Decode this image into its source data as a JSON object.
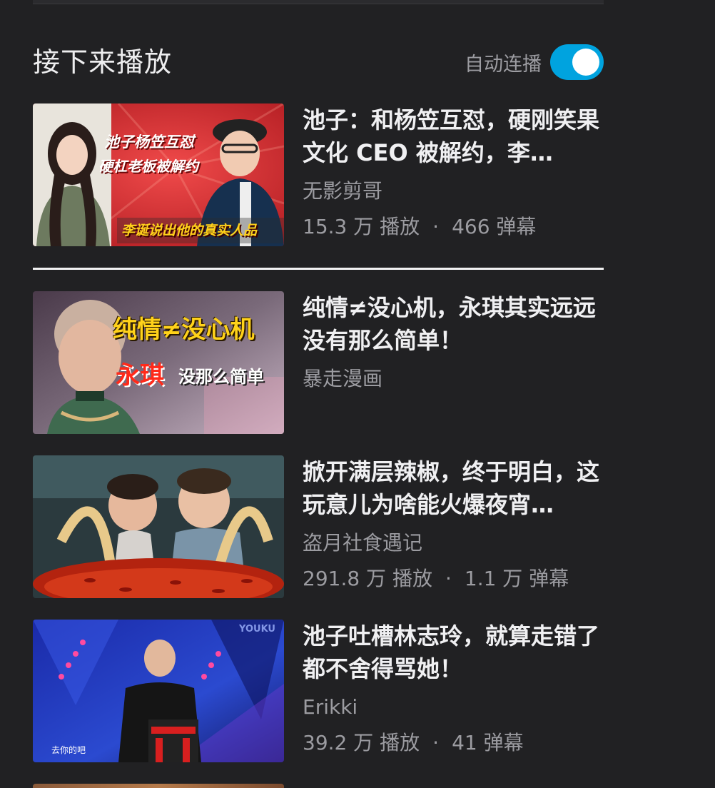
{
  "header": {
    "title": "接下来播放",
    "autoplay_label": "自动连播",
    "autoplay_on": true
  },
  "colors": {
    "background": "#212123",
    "accent": "#00a3df",
    "muted_text": "#9c9ca1"
  },
  "items": [
    {
      "title": "池子：和杨笠互怼，硬刚笑果文化 CEO 被解约，李…",
      "author": "无影剪哥",
      "plays": "15.3 万 播放",
      "danmaku": "466 弹幕",
      "thumb_text": [
        "池子杨笠互怼",
        "硬杠老板被解约",
        "李诞说出他的真实人品"
      ]
    },
    {
      "title": "纯情≠没心机，永琪其实远远没有那么简单！",
      "author": "暴走漫画",
      "thumb_text": [
        "纯情≠没心机",
        "永琪",
        "没那么简单"
      ]
    },
    {
      "title": "掀开满层辣椒，终于明白，这玩意儿为啥能火爆夜宵…",
      "author": "盗月社食遇记",
      "plays": "291.8 万 播放",
      "danmaku": "1.1 万 弹幕"
    },
    {
      "title": "池子吐槽林志玲，就算走错了都不舍得骂她！",
      "author": "Erikki",
      "plays": "39.2 万 播放",
      "danmaku": "41 弹幕",
      "thumb_text": [
        "YOUKU",
        "去你的吧"
      ]
    }
  ],
  "separator": "·"
}
